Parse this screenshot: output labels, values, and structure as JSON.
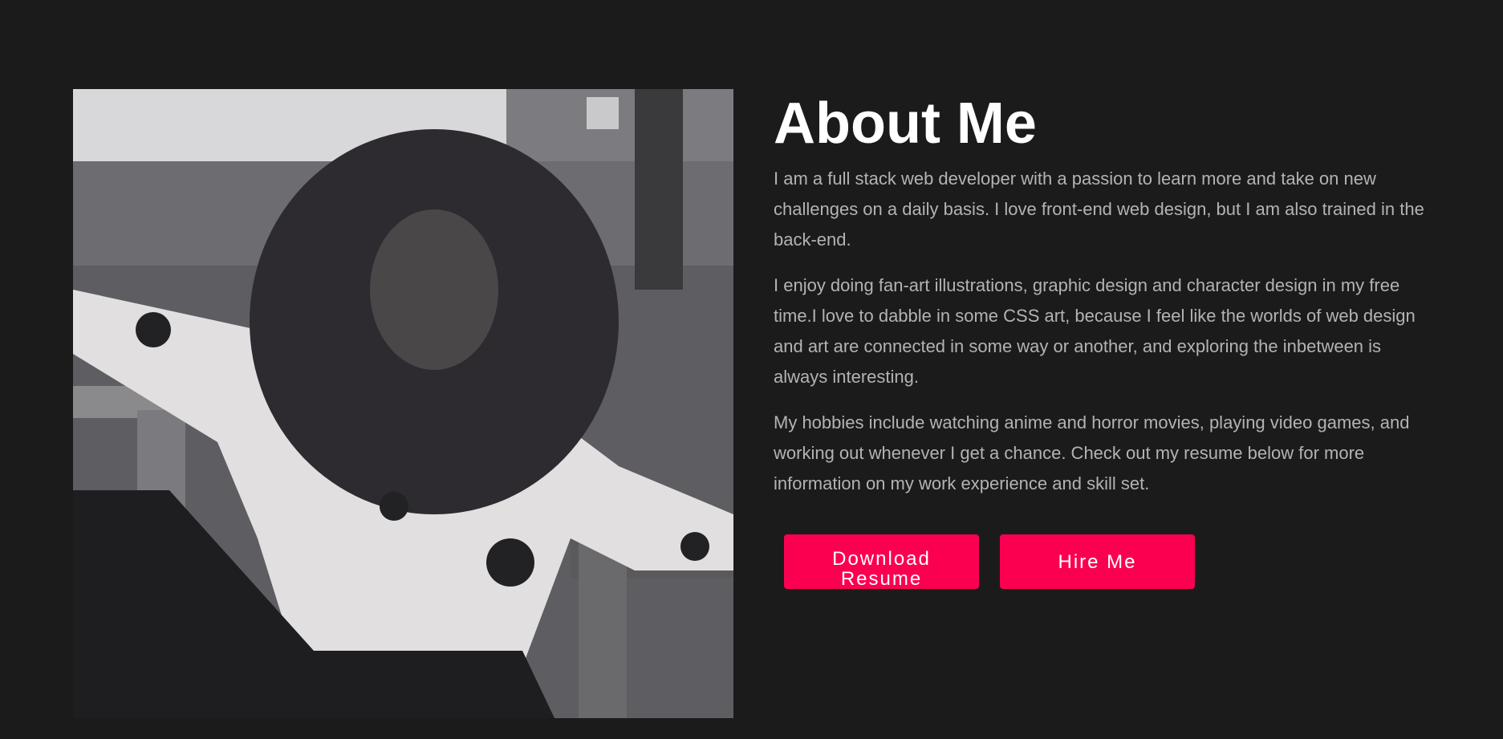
{
  "about": {
    "title": "About Me",
    "paragraphs": [
      "I am a full stack web developer with a passion to learn more and take on new challenges on a daily basis. I love front-end web design, but I am also trained in the back-end.",
      "I enjoy doing fan-art illustrations, graphic design and character design in my free time.I love to dabble in some CSS art, because I feel like the worlds of web design and art are connected in some way or another, and exploring the inbetween is always interesting.",
      "My hobbies include watching anime and horror movies, playing video games, and working out whenever I get a chance. Check out my resume below for more information on my work experience and skill set."
    ],
    "buttons": {
      "download_label": "Download Resume",
      "hire_label": "Hire Me"
    }
  },
  "colors": {
    "background": "#1b1b1c",
    "accent": "#fb0051",
    "heading": "#ffffff",
    "body_text": "#b3b3b5"
  }
}
